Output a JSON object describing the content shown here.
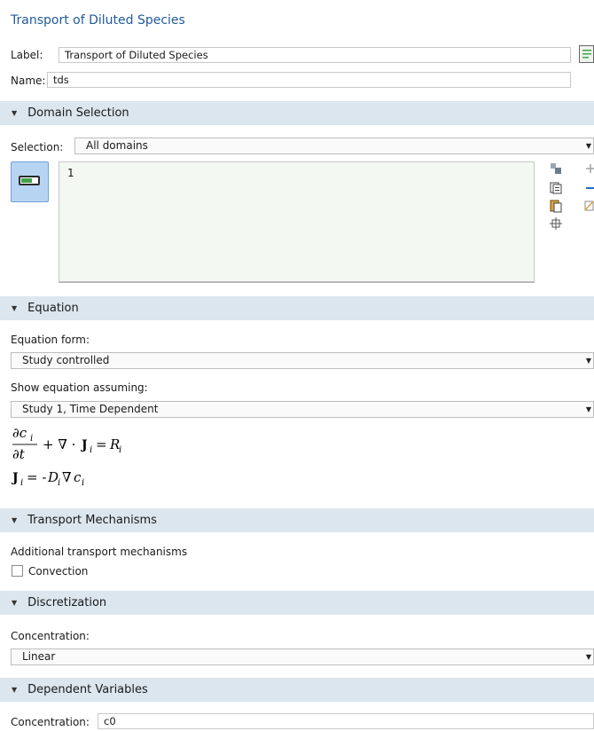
{
  "window_title": "Transport of Diluted Species",
  "label_field": {
    "label": "Label:",
    "value": "Transport of Diluted Species"
  },
  "name_field": {
    "label": "Name:",
    "value": "tds"
  },
  "icons": {
    "label_side": "comment-icon",
    "selection_toggle": "activation-toggle-icon",
    "selection_tools": [
      "copy-selection-icon",
      "paste-selection-icon",
      "clear-selection-icon",
      "zoom-to-selection-icon"
    ],
    "selection_edit": [
      "add-icon",
      "remove-icon",
      "zoom-extents-icon"
    ]
  },
  "domain_selection": {
    "header": "Domain Selection",
    "selection_label": "Selection:",
    "selection_value": "All domains",
    "items": [
      "1"
    ]
  },
  "equation": {
    "header": "Equation",
    "form_label": "Equation form:",
    "form_value": "Study controlled",
    "assume_label": "Show equation assuming:",
    "assume_value": "Study 1, Time Dependent"
  },
  "transport": {
    "header": "Transport Mechanisms",
    "additional_label": "Additional transport mechanisms",
    "convection_label": "Convection",
    "convection_checked": false
  },
  "discretization": {
    "header": "Discretization",
    "concentration_label": "Concentration:",
    "concentration_value": "Linear"
  },
  "dependent_variables": {
    "header": "Dependent Variables",
    "concentration_label": "Concentration:",
    "concentration_value": "c0"
  },
  "colors": {
    "title": "#1f5a99",
    "section_bg": "#dbe6ef",
    "toggle_bg": "#b7d5f3",
    "accent_blue": "#1f6fc4"
  }
}
